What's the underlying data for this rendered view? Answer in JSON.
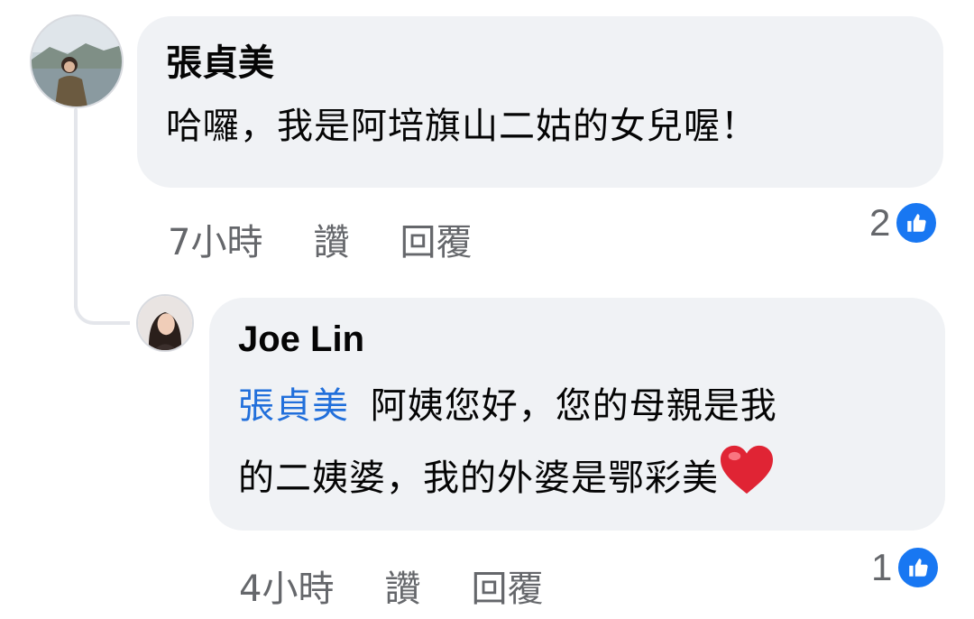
{
  "comments": [
    {
      "author": "張貞美",
      "text": "哈囉，我是阿培旗山二姑的女兒喔！",
      "time": "7小時",
      "like_label": "讚",
      "reply_label": "回覆",
      "reaction_count": "2",
      "reaction_icon": "like-icon"
    },
    {
      "author": "Joe Lin",
      "mention": "張貞美",
      "text_line1": "阿姨您好，您的母親是我",
      "text_line2": "的二姨婆，我的外婆是鄂彩美",
      "emoji": "heart-icon",
      "time": "4小時",
      "like_label": "讚",
      "reply_label": "回覆",
      "reaction_count": "1",
      "reaction_icon": "like-icon"
    }
  ],
  "colors": {
    "bubble": "#f0f2f5",
    "mention": "#216fdb",
    "meta_text": "#65676b",
    "like_blue": "#1877f2"
  }
}
